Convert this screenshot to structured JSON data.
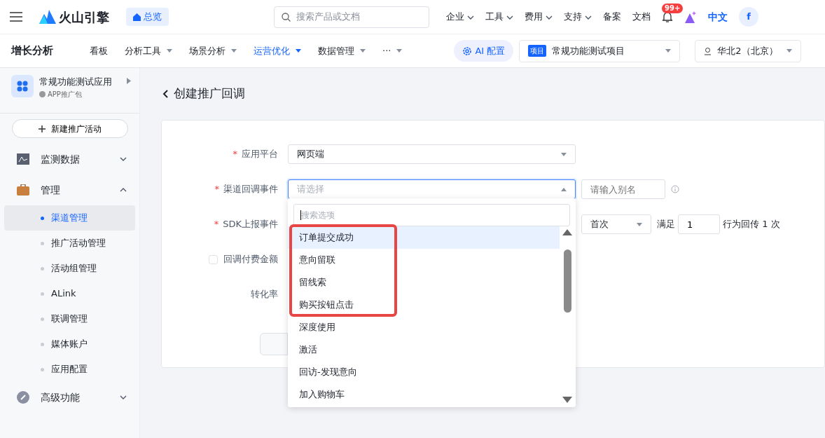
{
  "topbar": {
    "logo": "火山引擎",
    "home": "总览",
    "search": {
      "placeholder": "搜索产品或文档"
    },
    "links": [
      {
        "label": "企业",
        "dropdown": true
      },
      {
        "label": "工具",
        "dropdown": true
      },
      {
        "label": "费用",
        "dropdown": true
      },
      {
        "label": "支持",
        "dropdown": true
      },
      {
        "label": "备案",
        "dropdown": false
      },
      {
        "label": "文档",
        "dropdown": false
      }
    ],
    "badge": "99+",
    "language": "中文",
    "avatar": "f"
  },
  "subnav": {
    "title": "增长分析",
    "tabs": [
      {
        "label": "看板",
        "dropdown": false,
        "selected": false
      },
      {
        "label": "分析工具",
        "dropdown": true,
        "selected": false
      },
      {
        "label": "场景分析",
        "dropdown": true,
        "selected": false
      },
      {
        "label": "运营优化",
        "dropdown": true,
        "selected": true
      },
      {
        "label": "数据管理",
        "dropdown": true,
        "selected": false
      },
      {
        "label": "···",
        "dropdown": true,
        "selected": false
      }
    ],
    "ai": "AI 配置",
    "project_tag": "项目",
    "project": "常规功能测试项目",
    "region": "华北2（北京）"
  },
  "sidebar": {
    "app": "常规功能测试应用",
    "app_sub": "APP推广包",
    "new_button": "新建推广活动",
    "groups": [
      {
        "label": "监测数据",
        "expanded": false
      },
      {
        "label": "管理",
        "expanded": true,
        "children": [
          {
            "label": "渠道管理",
            "selected": true
          },
          {
            "label": "推广活动管理",
            "selected": false
          },
          {
            "label": "活动组管理",
            "selected": false
          },
          {
            "label": "ALink",
            "selected": false
          },
          {
            "label": "联调管理",
            "selected": false
          },
          {
            "label": "媒体账户",
            "selected": false
          },
          {
            "label": "应用配置",
            "selected": false
          }
        ]
      },
      {
        "label": "高级功能",
        "expanded": false
      }
    ]
  },
  "page": {
    "title": "创建推广回调",
    "form": [
      {
        "label": "应用平台",
        "required_mark": "*",
        "value": "网页端"
      },
      {
        "label": "渠道回调事件",
        "required_mark": "*",
        "placeholder": "请选择",
        "alias_placeholder": "请输入别名"
      },
      {
        "label": "SDK上报事件",
        "required_mark": "*",
        "frequency": "首次",
        "satisfy": "满足",
        "count": "1",
        "suffix": "行为回传 1 次"
      },
      {
        "label": "回调付费金额",
        "checked": false
      },
      {
        "label": "转化率"
      }
    ]
  },
  "dropdown": {
    "search_placeholder": "搜索选项",
    "options": [
      {
        "label": "订单提交成功",
        "selected": true
      },
      {
        "label": "意向留联",
        "selected": false
      },
      {
        "label": "留线索",
        "selected": false
      },
      {
        "label": "购买按钮点击",
        "selected": false
      },
      {
        "label": "深度使用",
        "selected": false
      },
      {
        "label": "激活",
        "selected": false
      },
      {
        "label": "回访-发现意向",
        "selected": false
      },
      {
        "label": "加入购物车",
        "selected": false
      }
    ]
  }
}
